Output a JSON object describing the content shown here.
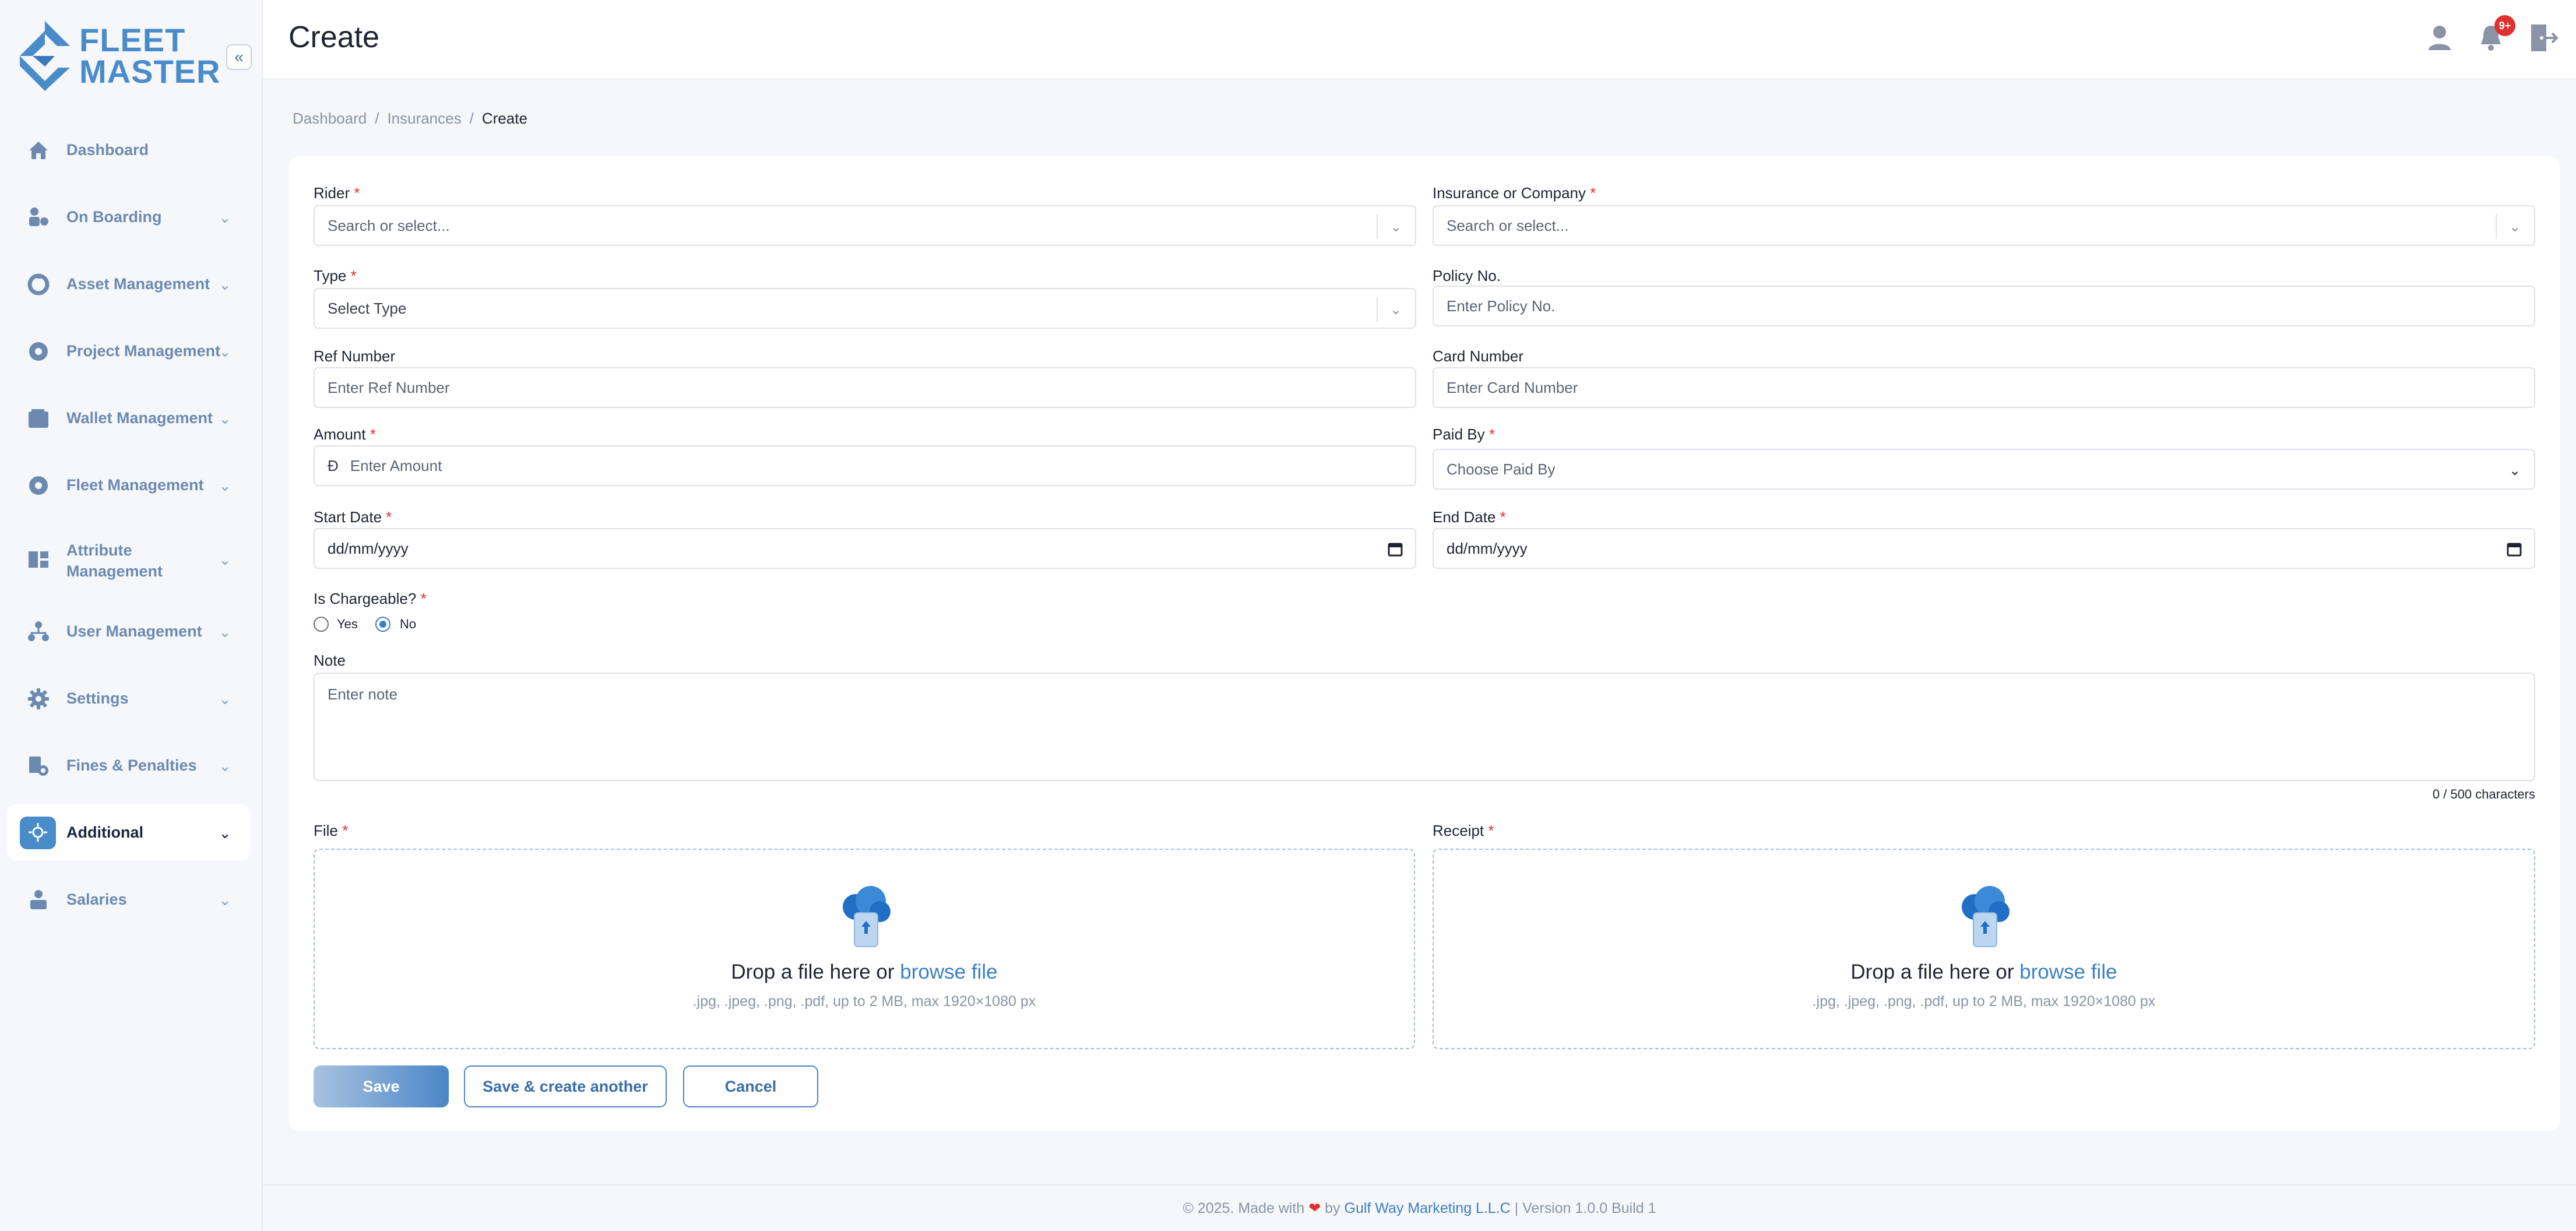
{
  "brand": {
    "line1": "FLEET",
    "line2": "MASTER",
    "color": "#4a8cca"
  },
  "header": {
    "title": "Create",
    "notification_badge": "9+"
  },
  "breadcrumb": {
    "items": [
      "Dashboard",
      "Insurances",
      "Create"
    ],
    "sep": "/"
  },
  "sidebar": {
    "items": [
      {
        "label": "Dashboard",
        "icon": "home-icon",
        "chevron": false
      },
      {
        "label": "On Boarding",
        "icon": "onboarding-icon",
        "chevron": true
      },
      {
        "label": "Asset Management",
        "icon": "asset-icon",
        "chevron": true
      },
      {
        "label": "Project Management",
        "icon": "project-icon",
        "chevron": true
      },
      {
        "label": "Wallet Management",
        "icon": "wallet-icon",
        "chevron": true
      },
      {
        "label": "Fleet Management",
        "icon": "fleet-icon",
        "chevron": true
      },
      {
        "label": "Attribute Management",
        "label_l1": "Attribute",
        "label_l2": "Management",
        "icon": "attribute-icon",
        "chevron": true
      },
      {
        "label": "User Management",
        "icon": "users-icon",
        "chevron": true
      },
      {
        "label": "Settings",
        "icon": "gear-icon",
        "chevron": true
      },
      {
        "label": "Fines & Penalties",
        "icon": "fines-icon",
        "chevron": true
      },
      {
        "label": "Additional",
        "icon": "additional-icon",
        "chevron": true,
        "active": true
      },
      {
        "label": "Salaries",
        "icon": "salaries-icon",
        "chevron": true
      }
    ]
  },
  "form": {
    "rider": {
      "label": "Rider",
      "placeholder": "Search or select..."
    },
    "insurance": {
      "label": "Insurance or Company",
      "placeholder": "Search or select..."
    },
    "type": {
      "label": "Type",
      "placeholder": "Select Type"
    },
    "policy": {
      "label": "Policy No.",
      "placeholder": "Enter Policy No."
    },
    "ref": {
      "label": "Ref Number",
      "placeholder": "Enter Ref Number"
    },
    "card": {
      "label": "Card Number",
      "placeholder": "Enter Card Number"
    },
    "amount": {
      "label": "Amount",
      "placeholder": "Enter Amount",
      "currency_symbol": "Đ"
    },
    "paid_by": {
      "label": "Paid By",
      "placeholder": "Choose Paid By"
    },
    "start_date": {
      "label": "Start Date",
      "value": "dd/mm/yyyy"
    },
    "end_date": {
      "label": "End Date",
      "value": "dd/mm/yyyy"
    },
    "chargeable": {
      "label": "Is Chargeable?",
      "options": [
        "Yes",
        "No"
      ],
      "selected": "No"
    },
    "note": {
      "label": "Note",
      "placeholder": "Enter note",
      "counter": "0 / 500 characters"
    },
    "file": {
      "label": "File",
      "drop_text": "Drop a file here or",
      "browse_text": "browse file",
      "hint": ".jpg, .jpeg, .png, .pdf, up to 2 MB, max 1920×1080 px"
    },
    "receipt": {
      "label": "Receipt",
      "drop_text": "Drop a file here or",
      "browse_text": "browse file",
      "hint": ".jpg, .jpeg, .png, .pdf, up to 2 MB, max 1920×1080 px"
    },
    "required_mark": "*"
  },
  "buttons": {
    "save": "Save",
    "save_another": "Save & create another",
    "cancel": "Cancel"
  },
  "footer": {
    "prefix": "© 2025. Made with",
    "heart": "❤",
    "by": "by",
    "company": "Gulf Way Marketing L.L.C",
    "suffix": "| Version 1.0.0 Build 1"
  }
}
